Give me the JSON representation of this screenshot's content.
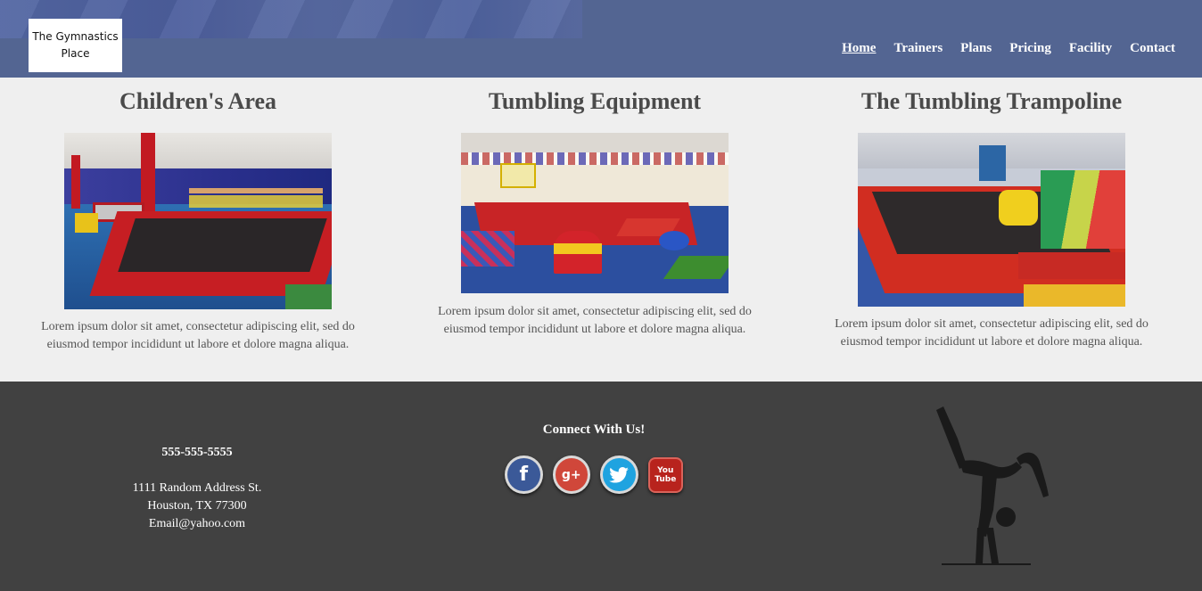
{
  "header": {
    "logo_text": "The Gymnastics Place",
    "nav": [
      {
        "label": "Home",
        "active": true
      },
      {
        "label": "Trainers",
        "active": false
      },
      {
        "label": "Plans",
        "active": false
      },
      {
        "label": "Pricing",
        "active": false
      },
      {
        "label": "Facility",
        "active": false
      },
      {
        "label": "Contact",
        "active": false
      }
    ],
    "background": "#536592"
  },
  "facility": {
    "areas": [
      {
        "title": "Children's Area",
        "image": "children-area-photo",
        "description": "Lorem ipsum dolor sit amet, consectetur adipiscing elit, sed do eiusmod tempor incididunt ut labore et dolore magna aliqua."
      },
      {
        "title": "Tumbling Equipment",
        "image": "tumbling-equipment-photo",
        "description": "Lorem ipsum dolor sit amet, consectetur adipiscing elit, sed do eiusmod tempor incididunt ut labore et dolore magna aliqua."
      },
      {
        "title": "The Tumbling Trampoline",
        "image": "tumbling-trampoline-photo",
        "description": "Lorem ipsum dolor sit amet, consectetur adipiscing elit, sed do eiusmod tempor incididunt ut labore et dolore magna aliqua."
      }
    ]
  },
  "footer": {
    "phone": "555-555-5555",
    "address_line1": "1111 Random Address St.",
    "address_line2": "Houston, TX 77300",
    "email": "Email@yahoo.com",
    "connect_heading": "Connect With Us!",
    "social": [
      {
        "name": "facebook-icon",
        "glyph": "f"
      },
      {
        "name": "google-plus-icon",
        "glyph": "g+"
      },
      {
        "name": "twitter-icon",
        "glyph": "t"
      },
      {
        "name": "youtube-icon",
        "glyph_top": "You",
        "glyph_bottom": "Tube"
      }
    ],
    "background": "#414141"
  }
}
